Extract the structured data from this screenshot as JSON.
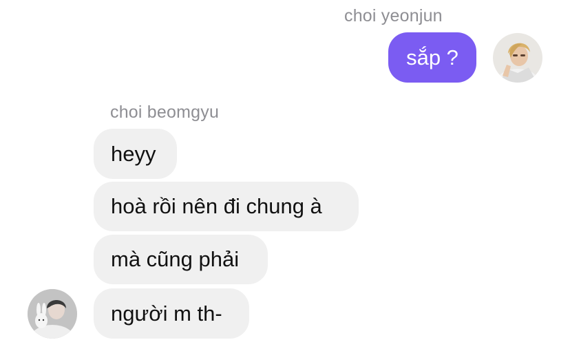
{
  "conversation": {
    "outgoing_sender": {
      "name": "choi yeonjun",
      "avatar_icon": "user-photo-avatar"
    },
    "incoming_sender": {
      "name": "choi beomgyu",
      "avatar_icon": "user-photo-avatar"
    },
    "messages": [
      {
        "text": "sắp ?"
      },
      {
        "text": "heyy"
      },
      {
        "text": "hoà rồi nên đi chung à"
      },
      {
        "text": "mà cũng phải"
      },
      {
        "text": "người m th-"
      }
    ],
    "colors": {
      "outgoing_bubble": "#7b5cf2",
      "incoming_bubble": "#f0f0f0",
      "sender_name": "#8e8e93"
    }
  }
}
